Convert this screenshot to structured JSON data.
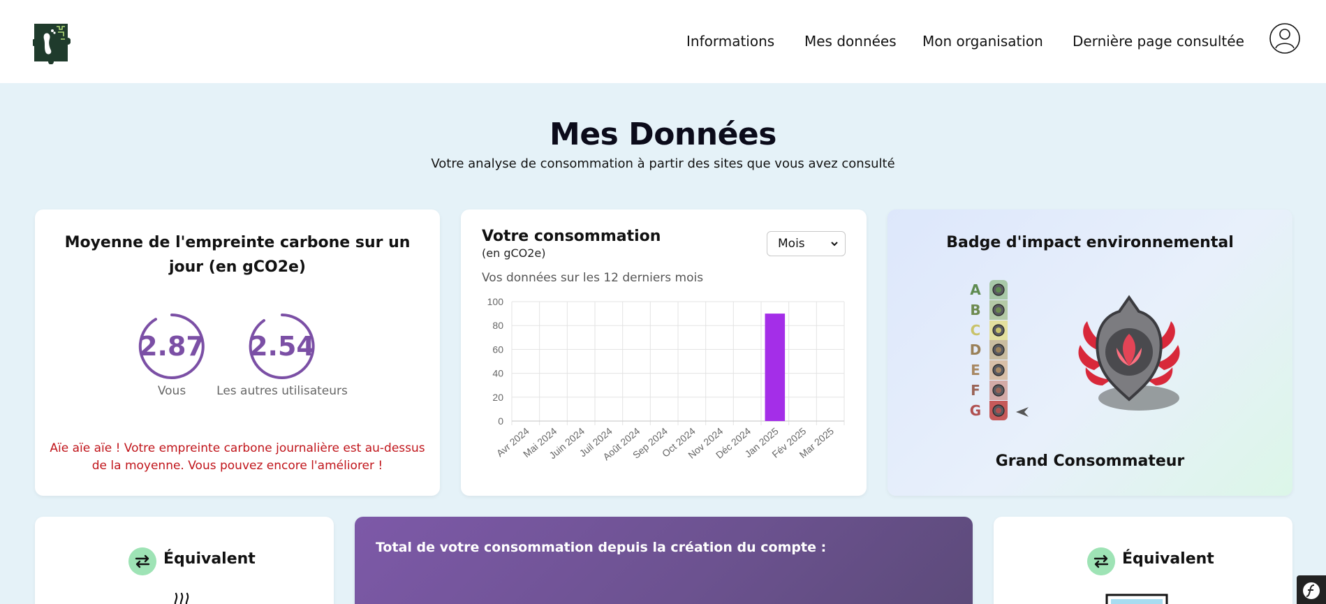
{
  "nav": {
    "links": [
      "Informations",
      "Mes données",
      "Mon organisation",
      "Dernière page consultée"
    ]
  },
  "header": {
    "title": "Mes Données",
    "subtitle": "Votre analyse de consommation à partir des sites que vous avez consulté"
  },
  "average_card": {
    "title": "Moyenne de l'empreinte carbone sur un jour (en gCO2e)",
    "you_value": "2.87",
    "you_label": "Vous",
    "others_value": "2.54",
    "others_label": "Les autres utilisateurs",
    "warning": "Aïe aïe aïe ! Votre empreinte carbone journalière est au-dessus de la moyenne. Vous pouvez encore l'améliorer !"
  },
  "consumption_card": {
    "title": "Votre consommation",
    "unit": "(en gCO2e)",
    "period_select": "Mois",
    "period_label": "Vos données sur les 12 derniers mois"
  },
  "chart_data": {
    "type": "bar",
    "categories": [
      "Avr 2024",
      "Mai 2024",
      "Juin 2024",
      "Juil 2024",
      "Août 2024",
      "Sep 2024",
      "Oct 2024",
      "Nov 2024",
      "Déc 2024",
      "Jan 2025",
      "Fév 2025",
      "Mar 2025"
    ],
    "values": [
      0,
      0,
      0,
      0,
      0,
      0,
      0,
      0,
      0,
      90,
      0,
      0
    ],
    "yticks": [
      0,
      20,
      40,
      60,
      80,
      100
    ],
    "ylim": [
      0,
      100
    ],
    "bar_color": "#a42ee8",
    "grid": true
  },
  "badge_card": {
    "title": "Badge d'impact environnemental",
    "grades": [
      {
        "letter": "A",
        "color": "#5d8a4f",
        "cell": "#a8c8a8"
      },
      {
        "letter": "B",
        "color": "#6d8a4f",
        "cell": "#b4c9a6"
      },
      {
        "letter": "C",
        "color": "#c9c36a",
        "cell": "#e3df9e"
      },
      {
        "letter": "D",
        "color": "#9a8058",
        "cell": "#c9bca0"
      },
      {
        "letter": "E",
        "color": "#a88863",
        "cell": "#d8bfa8"
      },
      {
        "letter": "F",
        "color": "#9a6457",
        "cell": "#d3aaa7"
      },
      {
        "letter": "G",
        "color": "#b05050",
        "cell": "#c65a5a"
      }
    ],
    "current_grade": "G",
    "badge_name": "Grand Consommateur"
  },
  "equivalent_left": {
    "title": "Équivalent"
  },
  "total_card": {
    "title": "Total de votre consommation depuis la création du compte :"
  },
  "equivalent_right": {
    "title": "Équivalent"
  },
  "colors": {
    "accent_purple": "#7b4fa5",
    "warning_red": "#c0141a",
    "equivalent_green": "#9ee3b5"
  }
}
